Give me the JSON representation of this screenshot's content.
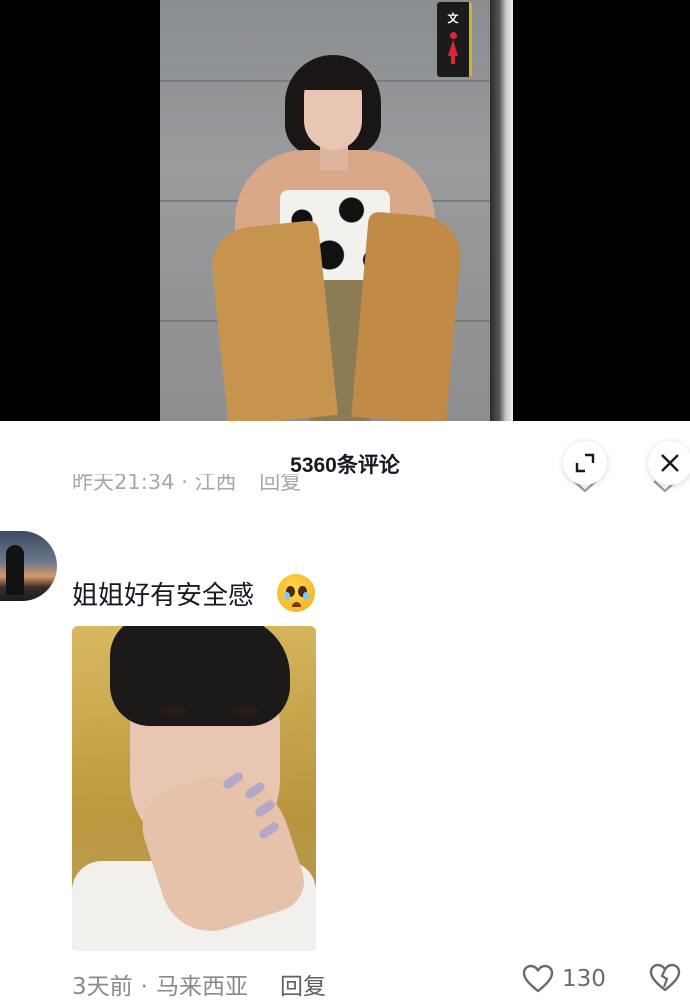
{
  "video": {
    "sign_text": "文"
  },
  "comments_header": {
    "count_label": "5360条评论",
    "previous_comment_meta": [
      "昨天21:34 · 江西",
      "回复"
    ]
  },
  "comment": {
    "text": "姐姐好有安全感",
    "emoji": "pleading-face-emoji",
    "time": "3天前",
    "location": "马来西亚",
    "dot": "·",
    "reply_label": "回复",
    "like_count": "130"
  },
  "colors": {
    "text_primary": "#161823",
    "text_secondary": "#8a8b91",
    "background": "#ffffff"
  }
}
